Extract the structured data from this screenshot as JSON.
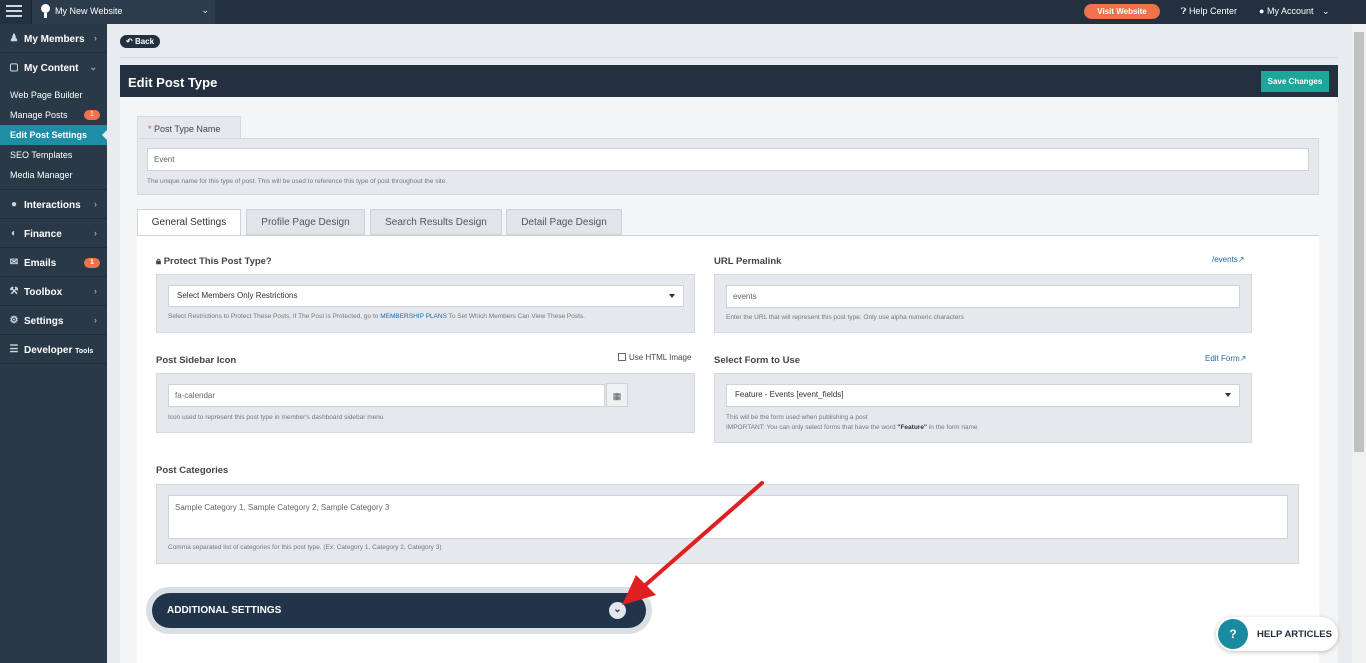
{
  "topbar": {
    "site_name": "My New Website",
    "visit_label": "Visit Website",
    "help_center": "Help Center",
    "my_account": "My Account"
  },
  "sidebar": {
    "items": [
      {
        "label": "My Members",
        "icon": "users-icon"
      },
      {
        "label": "My Content",
        "icon": "folder-open-icon"
      },
      {
        "label": "Interactions",
        "icon": "comments-icon"
      },
      {
        "label": "Finance",
        "icon": "finance-icon"
      },
      {
        "label": "Emails",
        "icon": "envelope-icon",
        "badge": "1"
      },
      {
        "label": "Toolbox",
        "icon": "wrench-icon"
      },
      {
        "label": "Settings",
        "icon": "gear-icon"
      },
      {
        "label": "Developer",
        "suffix": "Tools",
        "icon": "list-icon"
      }
    ],
    "sub_items": [
      {
        "label": "Web Page Builder"
      },
      {
        "label": "Manage Posts",
        "badge": "1"
      },
      {
        "label": "Edit Post Settings"
      },
      {
        "label": "SEO Templates"
      },
      {
        "label": "Media Manager"
      }
    ]
  },
  "page": {
    "back_label": "Back",
    "title": "Edit Post Type",
    "save_label": "Save Changes",
    "post_type_name": {
      "label": "Post Type Name",
      "required_mark": "*",
      "value": "Event",
      "help": "The unique name for this type of post. This will be used to reference this type of post throughout the site."
    },
    "tabs": [
      "General Settings",
      "Profile Page Design",
      "Search Results Design",
      "Detail Page Design"
    ],
    "protect": {
      "label": "Protect This Post Type?",
      "selected": "Select Members Only Restrictions",
      "help_before": "Select Restrictions to Protect These Posts, If The Post is Protected, go to ",
      "help_link": "MEMBERSHIP PLANS",
      "help_after": " To Set Which Members Can View These Posts."
    },
    "permalink": {
      "label": "URL Permalink",
      "link": "/events",
      "value": "events",
      "help": "Enter the URL that will represent this post type. Only use alpha numeric characters"
    },
    "sidebar_icon": {
      "label": "Post Sidebar Icon",
      "checkbox_label": "Use HTML Image",
      "value": "fa-calendar",
      "help": "Icon used to represent this post type in member's dashboard sidebar menu"
    },
    "form": {
      "label": "Select Form to Use",
      "link": "Edit Form",
      "selected": "Feature - Events [event_fields]",
      "help1": "This will be the form used when publishing a post",
      "help2_before": "IMPORTANT: You can only select forms that have the word ",
      "help2_bold": "\"Feature\"",
      "help2_after": " in the form name"
    },
    "categories": {
      "label": "Post Categories",
      "value": "Sample Category 1, Sample Category 2, Sample Category 3",
      "help": "Comma separated list of categories for this post type. (Ex: Category 1, Category 2, Category 3)"
    },
    "additional_settings": "ADDITIONAL SETTINGS"
  },
  "help_articles": "HELP ARTICLES",
  "colors": {
    "dark": "#22303f",
    "accent": "#1ba79a",
    "orange": "#f0724b",
    "annotation_arrow": "#e02020"
  }
}
